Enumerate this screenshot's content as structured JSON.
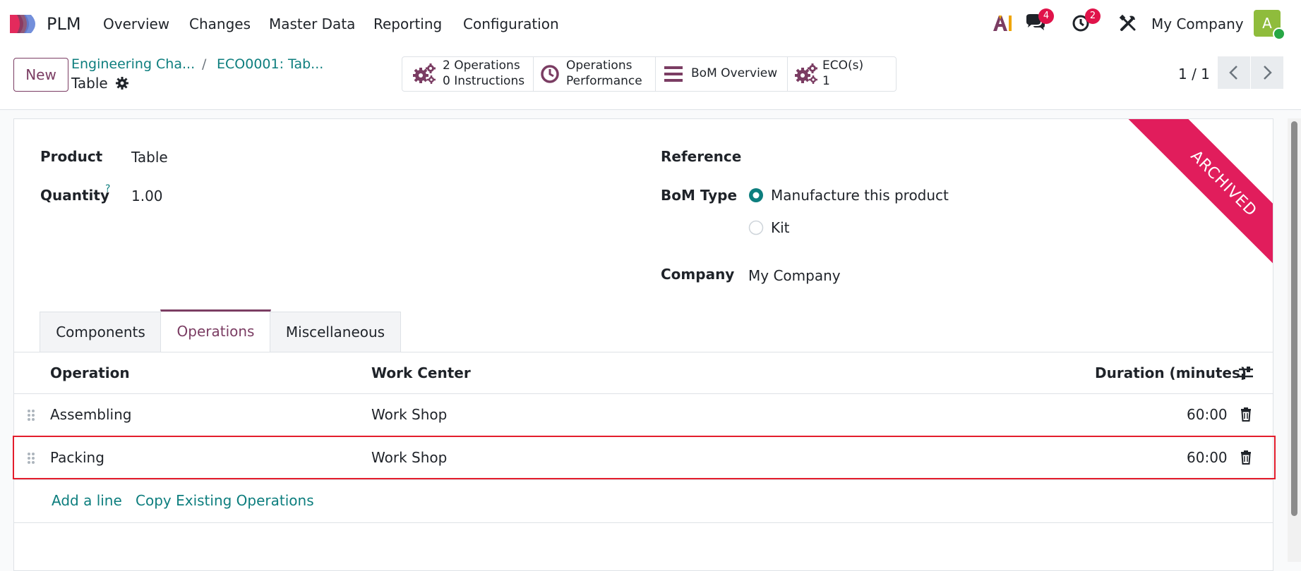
{
  "app": {
    "name": "PLM"
  },
  "menu": [
    "Overview",
    "Changes",
    "Master Data",
    "Reporting",
    "Configuration"
  ],
  "systray": {
    "messages_badge": "4",
    "activities_badge": "2",
    "company": "My Company",
    "avatar_letter": "A"
  },
  "control": {
    "new_label": "New",
    "breadcrumb": [
      "Engineering Cha...",
      "ECO0001: Tab..."
    ],
    "breadcrumb_sep": "/",
    "record_title": "Table",
    "smart_buttons": {
      "operations_count": "2",
      "operations_label": "Operations",
      "instructions_count": "0",
      "instructions_label": "Instructions",
      "performance_line1": "Operations",
      "performance_line2": "Performance",
      "bom_overview": "BoM Overview",
      "eco_label": "ECO(s)",
      "eco_count": "1"
    },
    "pager": "1 / 1"
  },
  "form": {
    "product_label": "Product",
    "product_value": "Table",
    "quantity_label": "Quantity",
    "quantity_help": "?",
    "quantity_value": "1.00",
    "reference_label": "Reference",
    "bom_type_label": "BoM Type",
    "bom_type_options": [
      "Manufacture this product",
      "Kit"
    ],
    "bom_type_selected": "Manufacture this product",
    "company_label": "Company",
    "company_value": "My Company",
    "ribbon": "ARCHIVED"
  },
  "tabs": [
    "Components",
    "Operations",
    "Miscellaneous"
  ],
  "active_tab": "Operations",
  "operations_table": {
    "columns": [
      "Operation",
      "Work Center",
      "Duration (minutes)"
    ],
    "rows": [
      {
        "operation": "Assembling",
        "work_center": "Work Shop",
        "duration": "60:00"
      },
      {
        "operation": "Packing",
        "work_center": "Work Shop",
        "duration": "60:00"
      }
    ],
    "add_line": "Add a line",
    "copy_existing": "Copy Existing Operations"
  },
  "colors": {
    "primary": "#7b3d63",
    "link": "#0d7e7e",
    "ribbon": "#e11d5c",
    "badge": "#e0134a",
    "highlight": "#e31d2c"
  }
}
